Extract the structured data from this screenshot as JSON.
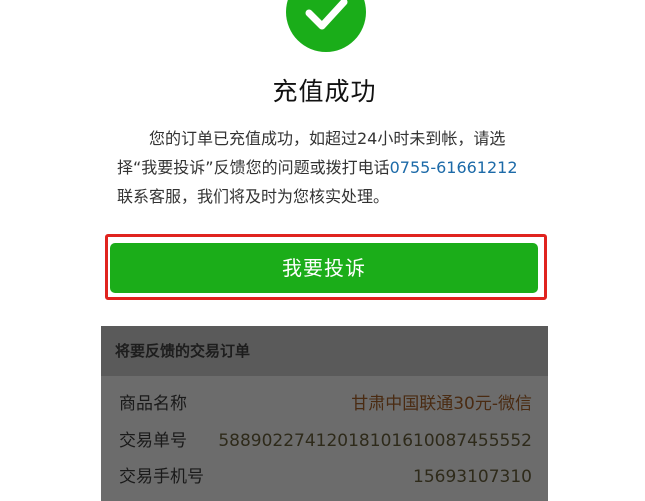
{
  "success": {
    "title": "充值成功",
    "message_before": "您的订单已充值成功，如超过24小时未到帐，请选择“我要投诉”反馈您的问题或拨打电话",
    "phone": "0755-61661212",
    "message_after": "联系客服，我们将及时为您核实处理。"
  },
  "complaint_button": {
    "label": "我要投诉"
  },
  "order_card": {
    "title": "将要反馈的交易订单",
    "rows": [
      {
        "key": "商品名称",
        "value": "甘肃中国联通30元-微信"
      },
      {
        "key": "交易单号",
        "value": "58890227412018101610087455552"
      },
      {
        "key": "交易手机号",
        "value": "15693107310"
      }
    ]
  },
  "colors": {
    "accent_green": "#1aad19",
    "highlight_red": "#e0231f",
    "link_blue": "#1c6aa8"
  },
  "icons": {
    "success": "check-circle-icon"
  }
}
